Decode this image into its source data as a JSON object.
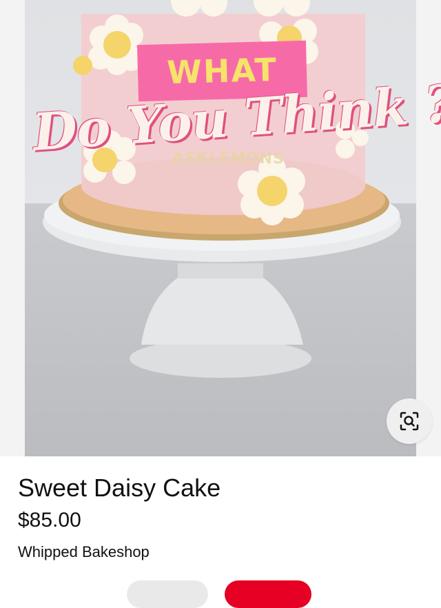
{
  "pin_image": {
    "alt": "Sweet Daisy Cake",
    "overlay_word": "WHAT",
    "overlay_script": "Do You Think ?",
    "watermark": "ASKLEMONS",
    "lens_icon": "visual-search-icon"
  },
  "product": {
    "title": "Sweet Daisy Cake",
    "price": "$85.00",
    "seller": "Whipped Bakeshop"
  },
  "colors": {
    "banner_pink": "#f76aa8",
    "banner_text_yellow": "#f6e36a",
    "primary_red": "#e60023"
  }
}
